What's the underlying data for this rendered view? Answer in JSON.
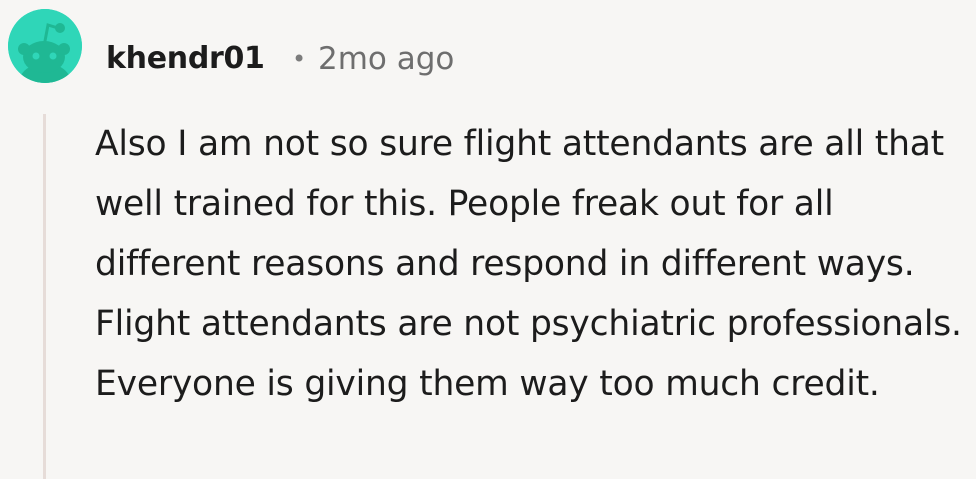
{
  "comment": {
    "author": "khendr01",
    "separator": "•",
    "timestamp": "2mo ago",
    "avatar_icon": "snoo-avatar-icon",
    "avatar_color": "#2fd6b8",
    "thread_line_color": "#e6dcd8",
    "body": "Also I am not so sure flight attendants are all that well trained for this. People freak out for all different reasons and respond in different ways. Flight attendants are not psychiatric professionals. Everyone is giving them way too much credit."
  }
}
